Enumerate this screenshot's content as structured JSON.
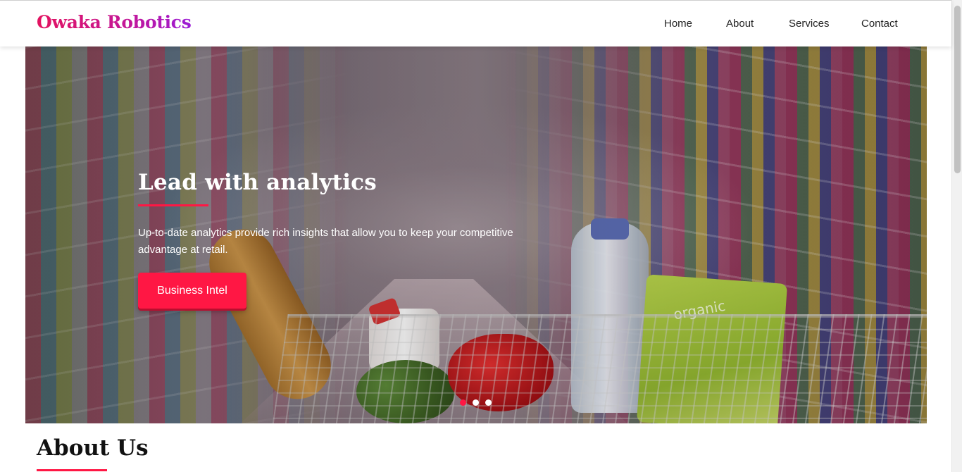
{
  "brand": {
    "name": "Owaka Robotics"
  },
  "nav": {
    "items": [
      {
        "label": "Home"
      },
      {
        "label": "About"
      },
      {
        "label": "Services"
      },
      {
        "label": "Contact"
      }
    ]
  },
  "hero": {
    "title": "Lead with analytics",
    "description": "Up-to-date analytics provide rich insights that allow you to keep your competitive advantage at retail.",
    "button_label": "Business Intel",
    "image_product_text": "organic",
    "carousel": {
      "slide_count": 3,
      "active_index": 0
    }
  },
  "about": {
    "title": "About Us"
  },
  "colors": {
    "accent": "#ff1744",
    "logo_gradient_start": "#e3125f",
    "logo_gradient_end": "#9b1bd6",
    "dot_inactive": "#ffffff"
  }
}
